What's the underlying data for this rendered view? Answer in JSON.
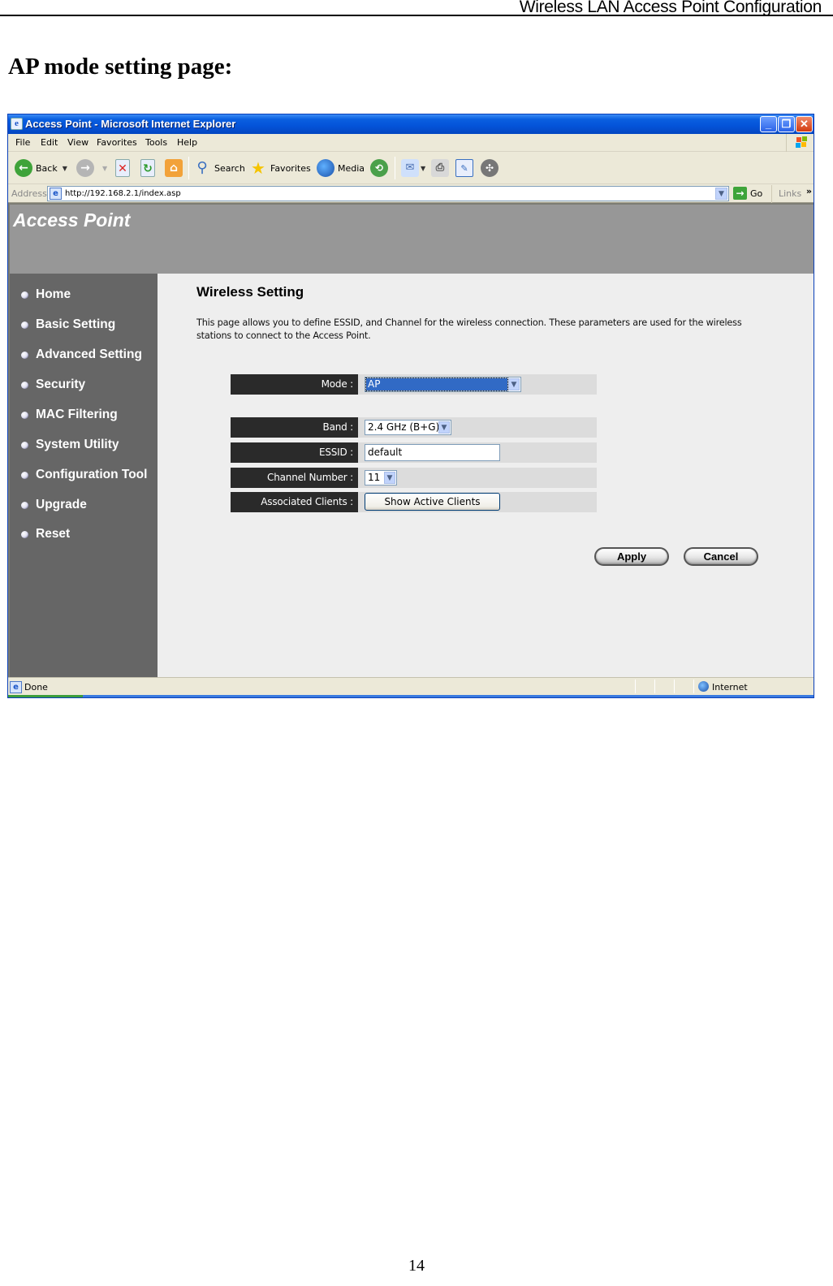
{
  "document": {
    "header_title": "Wireless LAN Access Point Configuration",
    "heading": "AP mode setting page:",
    "page_number": "14"
  },
  "browser": {
    "window_title": "Access Point - Microsoft Internet Explorer",
    "menu": [
      "File",
      "Edit",
      "View",
      "Favorites",
      "Tools",
      "Help"
    ],
    "toolbar": {
      "back": "Back",
      "search": "Search",
      "favorites": "Favorites",
      "media": "Media"
    },
    "address": {
      "label": "Address",
      "url": "http://192.168.2.1/index.asp",
      "go": "Go",
      "links": "Links"
    },
    "status": {
      "text": "Done",
      "zone": "Internet"
    }
  },
  "site": {
    "title": "Access Point",
    "nav": [
      {
        "label": "Home"
      },
      {
        "label": "Basic Setting"
      },
      {
        "label": "Advanced Setting"
      },
      {
        "label": "Security"
      },
      {
        "label": "MAC Filtering"
      },
      {
        "label": "System Utility"
      },
      {
        "label": "Configuration Tool"
      },
      {
        "label": "Upgrade"
      },
      {
        "label": "Reset"
      }
    ]
  },
  "content": {
    "title": "Wireless Setting",
    "description": "This page allows you to define ESSID, and Channel for the wireless connection. These parameters are used for the wireless stations to connect to the Access Point.",
    "form": {
      "mode": {
        "label": "Mode :",
        "value": "AP"
      },
      "band": {
        "label": "Band :",
        "value": "2.4 GHz (B+G)"
      },
      "essid": {
        "label": "ESSID :",
        "value": "default"
      },
      "channel": {
        "label": "Channel Number :",
        "value": "11"
      },
      "clients": {
        "label": "Associated Clients :",
        "button": "Show Active Clients"
      }
    },
    "apply": "Apply",
    "cancel": "Cancel"
  },
  "colors": {
    "sidebar": "#666666",
    "header": "#979797",
    "label_bg": "#2a2a2a",
    "selection": "#316ac5"
  }
}
